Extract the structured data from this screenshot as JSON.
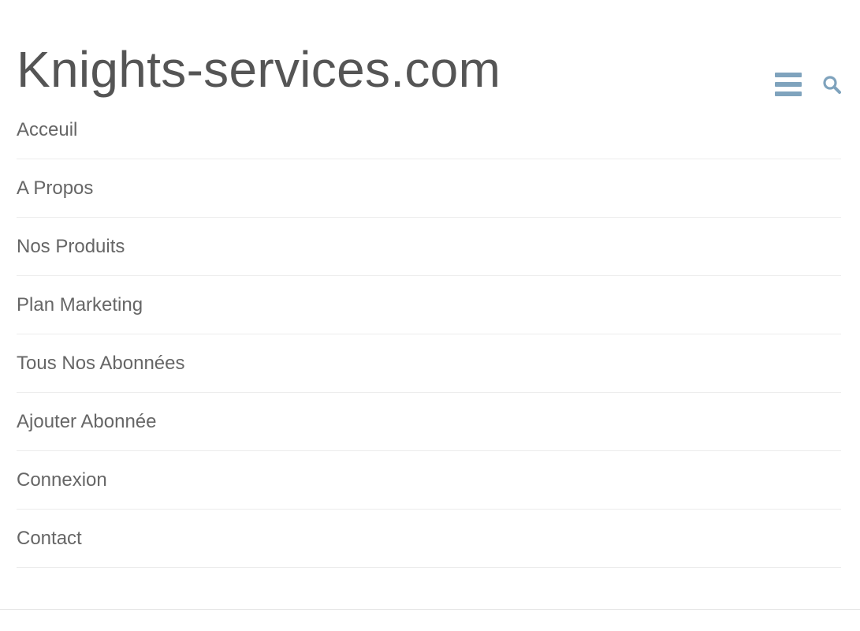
{
  "site": {
    "title": "Knights-services.com"
  },
  "header": {
    "menu_icon": "hamburger-menu-icon",
    "search_icon": "search-icon",
    "icon_color": "#7fa3bd"
  },
  "menu": {
    "items": [
      {
        "label": "Acceuil"
      },
      {
        "label": "A Propos"
      },
      {
        "label": "Nos Produits"
      },
      {
        "label": "Plan Marketing"
      },
      {
        "label": "Tous Nos Abonnées"
      },
      {
        "label": "Ajouter Abonnée"
      },
      {
        "label": "Connexion"
      },
      {
        "label": "Contact"
      }
    ]
  },
  "colors": {
    "title": "#555555",
    "menu_text": "#666666",
    "divider": "#ececec"
  }
}
